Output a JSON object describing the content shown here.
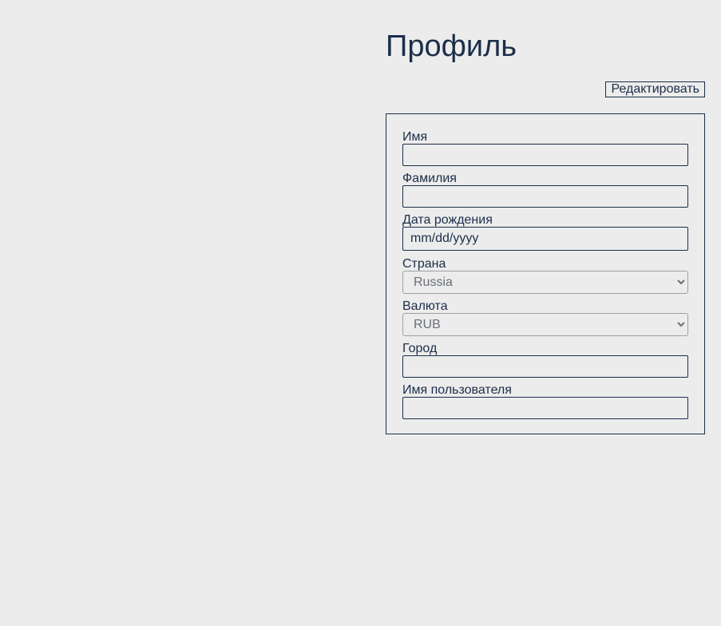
{
  "header": {
    "title": "Профиль",
    "edit_label": "Редактировать"
  },
  "form": {
    "first_name": {
      "label": "Имя",
      "value": ""
    },
    "last_name": {
      "label": "Фамилия",
      "value": ""
    },
    "birth_date": {
      "label": "Дата рождения",
      "placeholder": "mm/dd/yyyy"
    },
    "country": {
      "label": "Страна",
      "selected": "Russia"
    },
    "currency": {
      "label": "Валюта",
      "selected": "RUB"
    },
    "city": {
      "label": "Город",
      "value": ""
    },
    "username": {
      "label": "Имя пользователя",
      "value": ""
    }
  },
  "colors": {
    "text": "#1c2e4a",
    "background": "#ececec",
    "select_text": "#6a6f78"
  }
}
